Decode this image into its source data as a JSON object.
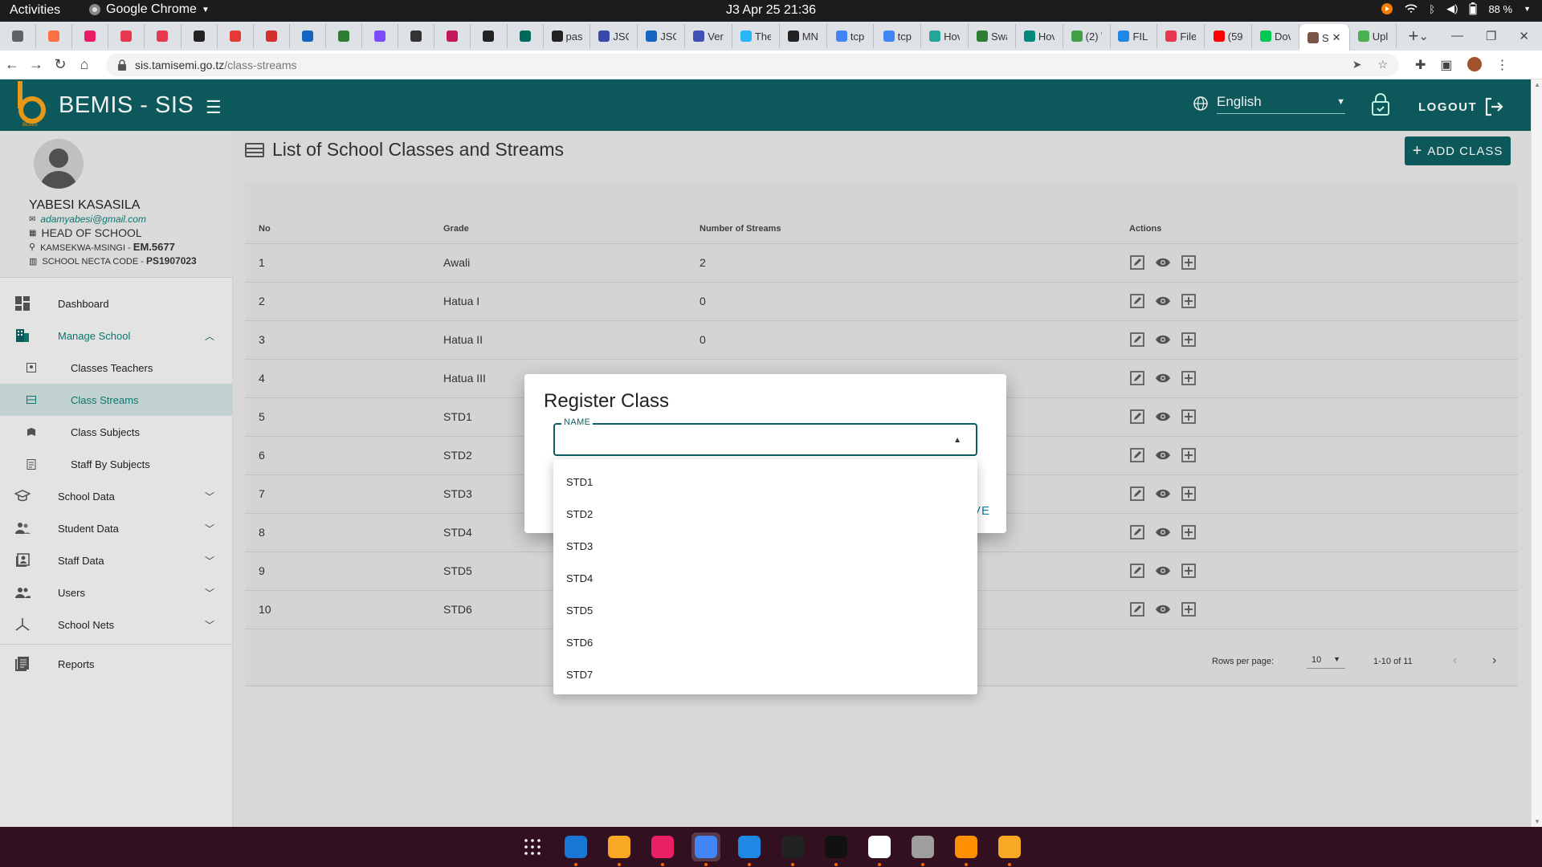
{
  "topbar": {
    "activities": "Activities",
    "app_name": "Google Chrome",
    "clock": "J3 Apr 25  21:36",
    "battery": "88 %"
  },
  "tabs": [
    {
      "label": "",
      "color": "#5f6368"
    },
    {
      "label": "",
      "color": "#ff7043"
    },
    {
      "label": "",
      "color": "#e91e63"
    },
    {
      "label": "",
      "color": "#e53950"
    },
    {
      "label": "",
      "color": "#e53950"
    },
    {
      "label": "",
      "color": "#222222"
    },
    {
      "label": "",
      "color": "#e53935"
    },
    {
      "label": "",
      "color": "#d32f2f"
    },
    {
      "label": "",
      "color": "#1565c0"
    },
    {
      "label": "",
      "color": "#2e7d32"
    },
    {
      "label": "",
      "color": "#7c4dff"
    },
    {
      "label": "",
      "color": "#333333"
    },
    {
      "label": "",
      "color": "#c2185b"
    },
    {
      "label": "",
      "color": "#222222"
    },
    {
      "label": "",
      "color": "#00695c"
    },
    {
      "label": "pas",
      "color": "#222222"
    },
    {
      "label": "JSC",
      "color": "#3949ab"
    },
    {
      "label": "JSC",
      "color": "#1565c0"
    },
    {
      "label": "Ver",
      "color": "#3f51b5"
    },
    {
      "label": "The",
      "color": "#29b6f6"
    },
    {
      "label": "MN",
      "color": "#222222"
    },
    {
      "label": "tcp",
      "color": "#4285f4"
    },
    {
      "label": "tcp",
      "color": "#4285f4"
    },
    {
      "label": "Hov",
      "color": "#26a69a"
    },
    {
      "label": "Swa",
      "color": "#2e7d32"
    },
    {
      "label": "Hov",
      "color": "#00897b"
    },
    {
      "label": "(2) \\",
      "color": "#43a047"
    },
    {
      "label": "FILE",
      "color": "#1e88e5"
    },
    {
      "label": "File",
      "color": "#e53950"
    },
    {
      "label": "(59",
      "color": "#ff0000"
    },
    {
      "label": "Dov",
      "color": "#00c853"
    },
    {
      "label": "S",
      "color": "#795548",
      "active": true
    },
    {
      "label": "Upl",
      "color": "#4caf50"
    }
  ],
  "browser": {
    "url_host": "sis.tamisemi.go.tz",
    "url_path": "/class-streams"
  },
  "app": {
    "brand": "BEMIS - SIS",
    "language": "English",
    "logout": "LOGOUT"
  },
  "profile": {
    "name": "YABESI KASASILA",
    "email": "adamyabesi@gmail.com",
    "role": "HEAD OF SCHOOL",
    "location": "KAMSEKWA-MSINGI - ",
    "location_code": "EM.5677",
    "necta_label": "SCHOOL NECTA CODE - ",
    "necta_code": "PS1907023"
  },
  "nav": {
    "dashboard": "Dashboard",
    "manage_school": "Manage School",
    "classes_teachers": "Classes Teachers",
    "class_streams": "Class Streams",
    "class_subjects": "Class Subjects",
    "staff_by_subjects": "Staff By Subjects",
    "school_data": "School Data",
    "student_data": "Student Data",
    "staff_data": "Staff Data",
    "users": "Users",
    "school_nets": "School Nets",
    "reports": "Reports"
  },
  "page": {
    "title": "List of School Classes and Streams",
    "add_class": "ADD CLASS"
  },
  "table": {
    "headers": [
      "No",
      "Grade",
      "Number of Streams",
      "Actions"
    ],
    "rows": [
      {
        "no": "1",
        "grade": "Awali",
        "streams": "2"
      },
      {
        "no": "2",
        "grade": "Hatua I",
        "streams": "0"
      },
      {
        "no": "3",
        "grade": "Hatua II",
        "streams": "0"
      },
      {
        "no": "4",
        "grade": "Hatua III",
        "streams": ""
      },
      {
        "no": "5",
        "grade": "STD1",
        "streams": ""
      },
      {
        "no": "6",
        "grade": "STD2",
        "streams": ""
      },
      {
        "no": "7",
        "grade": "STD3",
        "streams": ""
      },
      {
        "no": "8",
        "grade": "STD4",
        "streams": ""
      },
      {
        "no": "9",
        "grade": "STD5",
        "streams": ""
      },
      {
        "no": "10",
        "grade": "STD6",
        "streams": ""
      }
    ],
    "rows_per_page_label": "Rows per page:",
    "rows_per_page": "10",
    "range": "1-10 of 11"
  },
  "modal": {
    "title": "Register Class",
    "field_label": "NAME",
    "field_value": "",
    "save_visible": "VE",
    "options": [
      "STD1",
      "STD2",
      "STD3",
      "STD4",
      "STD5",
      "STD6",
      "STD7"
    ]
  },
  "colors": {
    "primary": "#0d5e60",
    "accent": "#0d7d75"
  },
  "dock": [
    {
      "name": "app-grid-icon",
      "color": "#ffffff"
    },
    {
      "name": "files-icon",
      "color": "#1976d2"
    },
    {
      "name": "text-editor-icon",
      "color": "#f9a825"
    },
    {
      "name": "music-icon",
      "color": "#e91e63"
    },
    {
      "name": "chrome-icon",
      "color": "#4285f4",
      "active": true
    },
    {
      "name": "vscode-icon",
      "color": "#1e88e5"
    },
    {
      "name": "terminal-icon",
      "color": "#222222"
    },
    {
      "name": "apple-tv-icon",
      "color": "#111111"
    },
    {
      "name": "video-editor-icon",
      "color": "#ffffff"
    },
    {
      "name": "settings-icon",
      "color": "#9e9e9e"
    },
    {
      "name": "vlc-icon",
      "color": "#ff8f00"
    },
    {
      "name": "code-folder-icon",
      "color": "#f9a825"
    }
  ]
}
